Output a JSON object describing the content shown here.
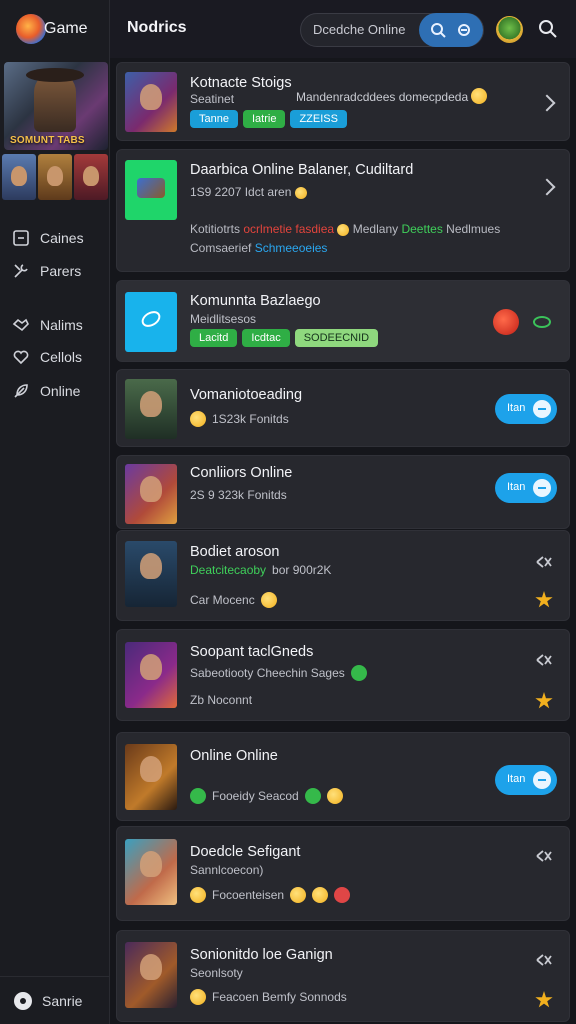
{
  "app": {
    "name": "Game",
    "banner_text": "SOMUNT TABS"
  },
  "sidebar": {
    "items": [
      {
        "label": "Caines",
        "icon": "square-dash-icon"
      },
      {
        "label": "Parers",
        "icon": "tools-icon"
      },
      {
        "label": "Nalims",
        "icon": "handshake-icon"
      },
      {
        "label": "Cellols",
        "icon": "heart-icon"
      },
      {
        "label": "Online",
        "icon": "feather-icon"
      }
    ],
    "footer_label": "Sanrie"
  },
  "header": {
    "title": "Nodrics"
  },
  "search": {
    "placeholder": "Dcedche Online"
  },
  "cards": [
    {
      "title": "Kotnacte Stoigs",
      "subtitle": "Seatinet",
      "desc": "Mandenradcddees domecpdeda",
      "tags": [
        "Tanne",
        "Iatrie",
        "ZZEISS"
      ]
    },
    {
      "title": "Daarbica Online Balaner, Cudiltard",
      "subtitle": "1S9 2207 Idct aren",
      "desc_1": "Kotitiotrts",
      "desc_2": "ocrlmetie fasdiea",
      "desc_3": "Medlany",
      "desc_4": "Deettes",
      "desc_5": "Nedlmues",
      "desc_6": "Comsaerief",
      "desc_7": "Schmeeoeies"
    },
    {
      "title": "Komunnta Bazlaego",
      "subtitle": "Meidlitsesos",
      "tags": [
        "Lacitd",
        "Icdtac",
        "SODEECNID"
      ]
    },
    {
      "title": "Vomaniotoeading",
      "subtitle": "1S23k Fonitds",
      "toggle": "Itan"
    },
    {
      "title": "Conliiors Online",
      "subtitle": "2S 9 323k Fonitds",
      "toggle": "Itan"
    },
    {
      "title": "Bodiet aroson",
      "subtitle_green": "Deatcitecaoby",
      "subtitle": "bor 900r2K",
      "meta": "Car Mocenc"
    },
    {
      "title": "Soopant taclGneds",
      "subtitle": "Sabeotiooty Cheechin Sages",
      "meta": "Zb Noconnt"
    },
    {
      "title": "Online Online",
      "meta": "Fooeidy Seacod",
      "toggle": "Itan"
    },
    {
      "title": "Doedcle Sefigant",
      "subtitle": "Sannlcoecon)",
      "meta": "Focoenteisen"
    },
    {
      "title": "Sonionitdo loe Ganign",
      "subtitle": "Seonlsoty",
      "meta": "Feacoen Bemfy Sonnods"
    }
  ]
}
